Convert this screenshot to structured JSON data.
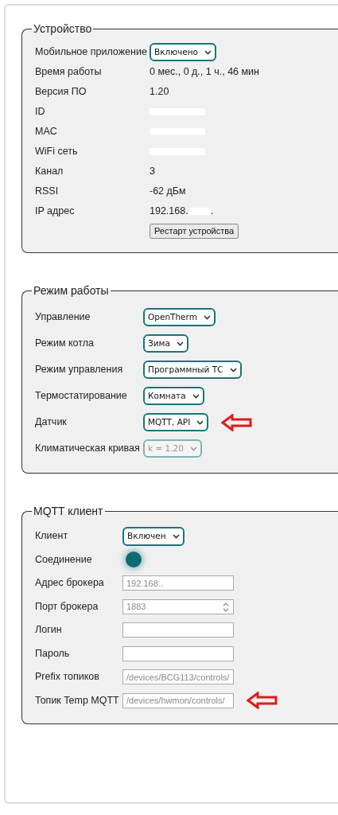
{
  "sections": [
    {
      "title": "Устройство",
      "rows": [
        {
          "label": "Мобильное приложение",
          "kind": "select",
          "value": "Включено",
          "disabled": false,
          "marked": false
        },
        {
          "label": "Время работы",
          "kind": "text",
          "value": "0 мес., 0 д., 1 ч., 46 мин"
        },
        {
          "label": "Версия ПО",
          "kind": "text",
          "value": "1.20"
        },
        {
          "label": "ID",
          "kind": "redacted"
        },
        {
          "label": "MAC",
          "kind": "redacted"
        },
        {
          "label": "WiFi сеть",
          "kind": "redacted"
        },
        {
          "label": "Канал",
          "kind": "text",
          "value": "3"
        },
        {
          "label": "RSSI",
          "kind": "text",
          "value": "-62 дБм"
        },
        {
          "label": "IP адрес",
          "kind": "partial",
          "value": "192.168.",
          "tail": "."
        },
        {
          "kind": "button",
          "value": "Рестарт устройства"
        }
      ]
    },
    {
      "title": "Режим работы",
      "rows": [
        {
          "label": "Управление",
          "kind": "select",
          "value": "OpenTherm",
          "disabled": false,
          "marked": false
        },
        {
          "label": "Режим котла",
          "kind": "select",
          "value": "Зима",
          "disabled": false,
          "marked": false
        },
        {
          "label": "Режим управления",
          "kind": "select",
          "value": "Программный ТС",
          "disabled": false,
          "marked": false
        },
        {
          "label": "Термостатирование",
          "kind": "select",
          "value": "Комната",
          "disabled": false,
          "marked": false
        },
        {
          "label": "Датчик",
          "kind": "select",
          "value": "MQTT, API",
          "disabled": false,
          "marked": true
        },
        {
          "label": "Климатическая кривая",
          "kind": "select",
          "value": "k = 1.20",
          "disabled": true,
          "marked": false
        }
      ]
    },
    {
      "title": "MQTT клиент",
      "rows": [
        {
          "label": "Клиент",
          "kind": "select",
          "value": "Включен",
          "disabled": false,
          "marked": false
        },
        {
          "label": "Соединение",
          "kind": "indicator",
          "on": true
        },
        {
          "label": "Адрес брокера",
          "kind": "input",
          "placeholder": "192.168..",
          "marked": false
        },
        {
          "label": "Порт брокера",
          "kind": "number",
          "placeholder": "1883",
          "marked": false
        },
        {
          "label": "Логин",
          "kind": "input",
          "marked": false
        },
        {
          "label": "Пароль",
          "kind": "input",
          "marked": false
        },
        {
          "label": "Prefix топиков",
          "kind": "input",
          "placeholder": "/devices/BCG113/controls/",
          "marked": false
        },
        {
          "label": "Топик Temp MQTT",
          "kind": "input",
          "placeholder": "/devices/hwmon/controls/",
          "marked": true
        }
      ]
    }
  ]
}
